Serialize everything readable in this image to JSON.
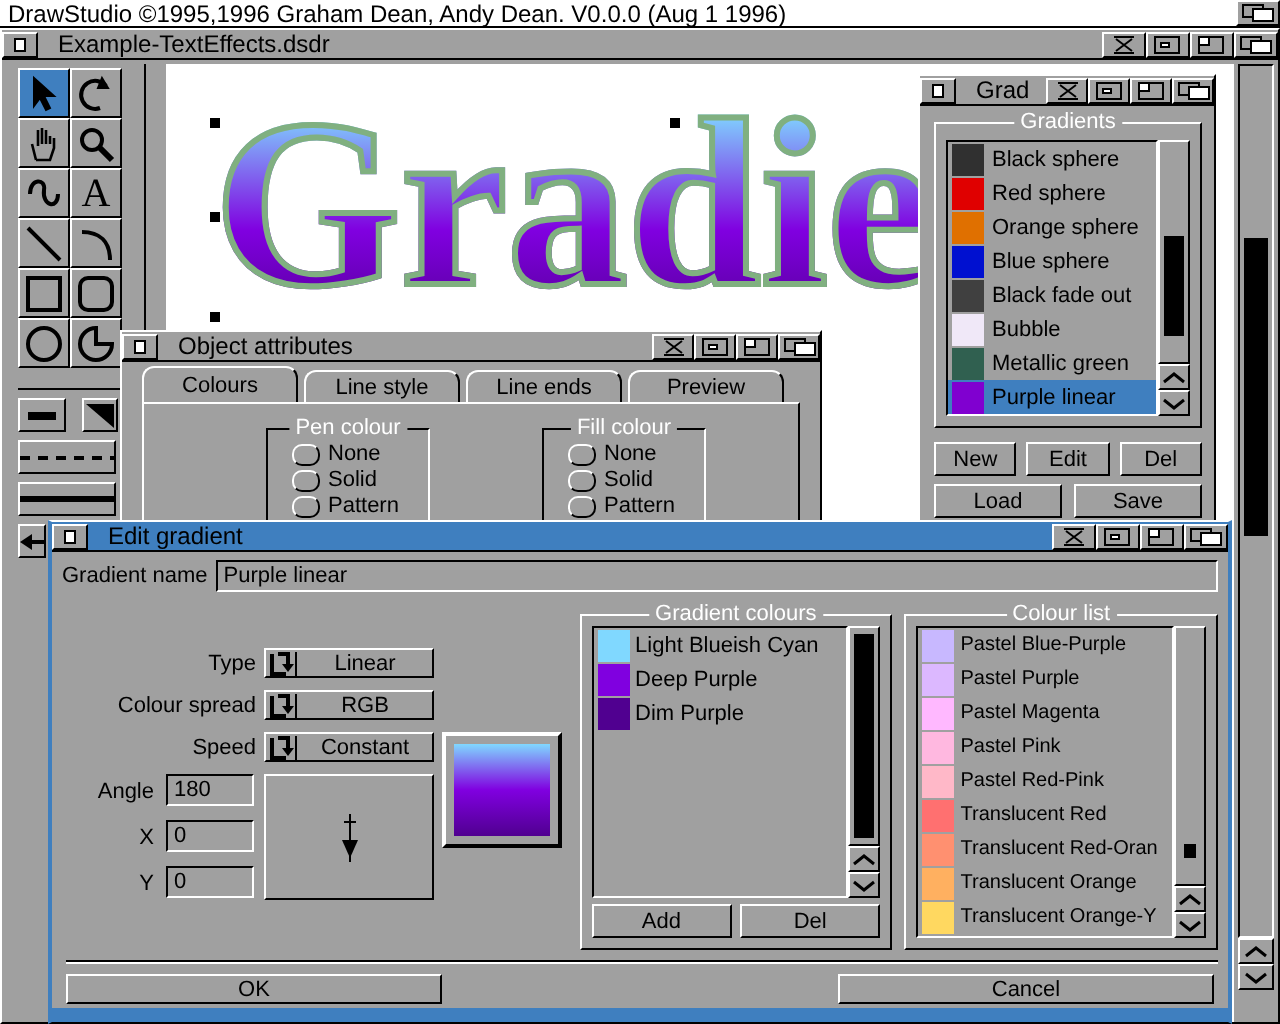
{
  "screen_title": "DrawStudio ©1995,1996 Graham Dean, Andy Dean. V0.0.0 (Aug  1 1996)",
  "main_window": {
    "title": "Example-TextEffects.dsdr",
    "canvas_text": "Gradie",
    "tools": [
      {
        "kind": "pointer",
        "selected": true
      },
      {
        "kind": "rotate",
        "selected": false
      },
      {
        "kind": "hand",
        "selected": false
      },
      {
        "kind": "zoom",
        "selected": false
      },
      {
        "kind": "curve",
        "selected": false
      },
      {
        "kind": "text",
        "label": "A",
        "selected": false
      },
      {
        "kind": "line",
        "selected": false
      },
      {
        "kind": "arc",
        "selected": false
      },
      {
        "kind": "rect",
        "selected": false
      },
      {
        "kind": "roundrect",
        "selected": false
      },
      {
        "kind": "circle",
        "selected": false
      },
      {
        "kind": "pie",
        "selected": false
      }
    ]
  },
  "gradients_window": {
    "title": "Grad",
    "group_title": "Gradients",
    "items": [
      {
        "name": "Black sphere",
        "color": "#303030",
        "selected": false
      },
      {
        "name": "Red sphere",
        "color": "#e00000",
        "selected": false
      },
      {
        "name": "Orange sphere",
        "color": "#e07000",
        "selected": false
      },
      {
        "name": "Blue sphere",
        "color": "#0010d0",
        "selected": false
      },
      {
        "name": "Black fade out",
        "color": "#404040",
        "selected": false
      },
      {
        "name": "Bubble",
        "color": "#f0e8f8",
        "selected": false
      },
      {
        "name": "Metallic green",
        "color": "#306050",
        "selected": false
      },
      {
        "name": "Purple linear",
        "color": "#8000d0",
        "selected": true
      }
    ],
    "buttons": [
      "New",
      "Edit",
      "Del",
      "Load",
      "Save"
    ]
  },
  "object_attributes": {
    "title": "Object attributes",
    "tabs": [
      {
        "label": "Colours",
        "selected": true
      },
      {
        "label": "Line style",
        "selected": false
      },
      {
        "label": "Line ends",
        "selected": false
      },
      {
        "label": "Preview",
        "selected": false
      }
    ],
    "groups": [
      {
        "title": "Pen colour",
        "options": [
          {
            "label": "None",
            "selected": false
          },
          {
            "label": "Solid",
            "selected": false
          },
          {
            "label": "Pattern",
            "selected": false
          }
        ]
      },
      {
        "title": "Fill colour",
        "options": [
          {
            "label": "None",
            "selected": false
          },
          {
            "label": "Solid",
            "selected": false
          },
          {
            "label": "Pattern",
            "selected": false
          }
        ]
      }
    ]
  },
  "edit_gradient": {
    "title": "Edit gradient",
    "name_label": "Gradient name",
    "name_value": "Purple linear",
    "cycles": [
      {
        "label": "Type",
        "value": "Linear"
      },
      {
        "label": "Colour spread",
        "value": "RGB"
      },
      {
        "label": "Speed",
        "value": "Constant"
      }
    ],
    "fields": [
      {
        "label": "Angle",
        "value": "180"
      },
      {
        "label": "X",
        "value": "0"
      },
      {
        "label": "Y",
        "value": "0"
      }
    ],
    "gradient_colours": {
      "title": "Gradient colours",
      "items": [
        {
          "name": "Light Blueish Cyan",
          "color": "#80d8ff"
        },
        {
          "name": "Deep Purple",
          "color": "#8000e0"
        },
        {
          "name": "Dim Purple",
          "color": "#500090"
        }
      ],
      "buttons": [
        "Add",
        "Del"
      ]
    },
    "colour_list": {
      "title": "Colour list",
      "items": [
        {
          "name": "Pastel Blue-Purple",
          "color": "#c8b8ff"
        },
        {
          "name": "Pastel Purple",
          "color": "#dcb8ff"
        },
        {
          "name": "Pastel Magenta",
          "color": "#ffb8ff"
        },
        {
          "name": "Pastel Pink",
          "color": "#ffb8e0"
        },
        {
          "name": "Pastel Red-Pink",
          "color": "#ffb8c8"
        },
        {
          "name": "Translucent Red",
          "color": "#ff7070"
        },
        {
          "name": "Translucent Red-Oran",
          "color": "#ff9070"
        },
        {
          "name": "Translucent Orange",
          "color": "#ffb060"
        },
        {
          "name": "Translucent Orange-Y",
          "color": "#ffd860"
        }
      ]
    },
    "ok": "OK",
    "cancel": "Cancel"
  }
}
